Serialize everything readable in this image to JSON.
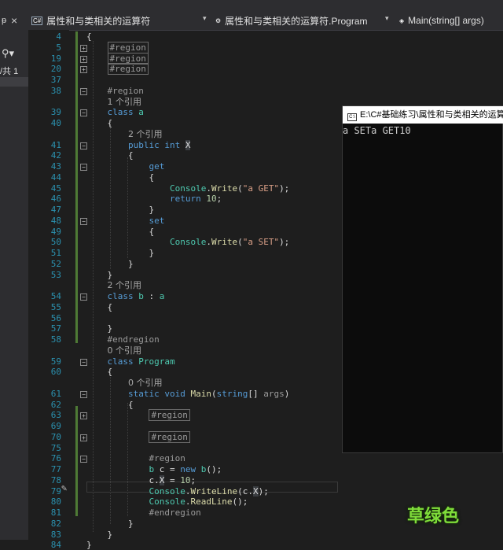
{
  "window": {
    "nav_file": "属性和与类相关的运算符",
    "nav_class": "属性和与类相关的运算符.Program",
    "nav_member": "Main(string[] args)",
    "icons": {
      "file": "csharp-file-icon",
      "class": "class-icon",
      "member": "method-icon"
    }
  },
  "side": {
    "pin": "ᵽ",
    "close": "×",
    "search": "⚲▾",
    "count": "/共 1"
  },
  "lines": [
    {
      "n": "4",
      "tokens": [
        {
          "t": "{",
          "c": ""
        }
      ]
    },
    {
      "n": "5",
      "tokens": [
        {
          "t": "    ",
          "c": ""
        },
        {
          "t": "#region",
          "c": "box"
        }
      ]
    },
    {
      "n": "19",
      "tokens": [
        {
          "t": "    ",
          "c": ""
        },
        {
          "t": "#region",
          "c": "box"
        }
      ]
    },
    {
      "n": "20",
      "tokens": [
        {
          "t": "    ",
          "c": ""
        },
        {
          "t": "#region",
          "c": "box"
        }
      ]
    },
    {
      "n": "37",
      "tokens": []
    },
    {
      "n": "38",
      "tokens": [
        {
          "t": "    ",
          "c": ""
        },
        {
          "t": "#region",
          "c": "grey"
        }
      ]
    },
    {
      "n": "",
      "tokens": [
        {
          "t": "    ",
          "c": ""
        },
        {
          "t": "1 个引用",
          "c": "ref"
        }
      ]
    },
    {
      "n": "39",
      "tokens": [
        {
          "t": "    ",
          "c": ""
        },
        {
          "t": "class",
          "c": "kw"
        },
        {
          "t": " ",
          "c": ""
        },
        {
          "t": "a",
          "c": "ty"
        }
      ]
    },
    {
      "n": "40",
      "tokens": [
        {
          "t": "    {",
          "c": ""
        }
      ]
    },
    {
      "n": "",
      "tokens": [
        {
          "t": "        ",
          "c": ""
        },
        {
          "t": "2 个引用",
          "c": "ref"
        }
      ]
    },
    {
      "n": "41",
      "tokens": [
        {
          "t": "        ",
          "c": ""
        },
        {
          "t": "public",
          "c": "kw"
        },
        {
          "t": " ",
          "c": ""
        },
        {
          "t": "int",
          "c": "kw"
        },
        {
          "t": " ",
          "c": ""
        },
        {
          "t": "X",
          "c": "hl"
        }
      ]
    },
    {
      "n": "42",
      "tokens": [
        {
          "t": "        {",
          "c": ""
        }
      ]
    },
    {
      "n": "43",
      "tokens": [
        {
          "t": "            ",
          "c": ""
        },
        {
          "t": "get",
          "c": "kw"
        }
      ]
    },
    {
      "n": "44",
      "tokens": [
        {
          "t": "            {",
          "c": ""
        }
      ]
    },
    {
      "n": "45",
      "tokens": [
        {
          "t": "                ",
          "c": ""
        },
        {
          "t": "Console",
          "c": "ty"
        },
        {
          "t": ".",
          "c": ""
        },
        {
          "t": "Write",
          "c": "me"
        },
        {
          "t": "(",
          "c": ""
        },
        {
          "t": "\"a GET\"",
          "c": "str"
        },
        {
          "t": ");",
          "c": ""
        }
      ]
    },
    {
      "n": "46",
      "tokens": [
        {
          "t": "                ",
          "c": ""
        },
        {
          "t": "return",
          "c": "kw"
        },
        {
          "t": " ",
          "c": ""
        },
        {
          "t": "10",
          "c": "num"
        },
        {
          "t": ";",
          "c": ""
        }
      ]
    },
    {
      "n": "47",
      "tokens": [
        {
          "t": "            }",
          "c": ""
        }
      ]
    },
    {
      "n": "48",
      "tokens": [
        {
          "t": "            ",
          "c": ""
        },
        {
          "t": "set",
          "c": "kw"
        }
      ]
    },
    {
      "n": "49",
      "tokens": [
        {
          "t": "            {",
          "c": ""
        }
      ]
    },
    {
      "n": "50",
      "tokens": [
        {
          "t": "                ",
          "c": ""
        },
        {
          "t": "Console",
          "c": "ty"
        },
        {
          "t": ".",
          "c": ""
        },
        {
          "t": "Write",
          "c": "me"
        },
        {
          "t": "(",
          "c": ""
        },
        {
          "t": "\"a SET\"",
          "c": "str"
        },
        {
          "t": ");",
          "c": ""
        }
      ]
    },
    {
      "n": "51",
      "tokens": [
        {
          "t": "            }",
          "c": ""
        }
      ]
    },
    {
      "n": "52",
      "tokens": [
        {
          "t": "        }",
          "c": ""
        }
      ]
    },
    {
      "n": "53",
      "tokens": [
        {
          "t": "    }",
          "c": ""
        }
      ]
    },
    {
      "n": "",
      "tokens": [
        {
          "t": "    ",
          "c": ""
        },
        {
          "t": "2 个引用",
          "c": "ref"
        }
      ]
    },
    {
      "n": "54",
      "tokens": [
        {
          "t": "    ",
          "c": ""
        },
        {
          "t": "class",
          "c": "kw"
        },
        {
          "t": " ",
          "c": ""
        },
        {
          "t": "b",
          "c": "ty"
        },
        {
          "t": " : ",
          "c": ""
        },
        {
          "t": "a",
          "c": "ty"
        }
      ]
    },
    {
      "n": "55",
      "tokens": [
        {
          "t": "    {",
          "c": ""
        }
      ]
    },
    {
      "n": "56",
      "tokens": []
    },
    {
      "n": "57",
      "tokens": [
        {
          "t": "    }",
          "c": ""
        }
      ]
    },
    {
      "n": "58",
      "tokens": [
        {
          "t": "    ",
          "c": ""
        },
        {
          "t": "#endregion",
          "c": "grey"
        }
      ]
    },
    {
      "n": "",
      "tokens": [
        {
          "t": "    ",
          "c": ""
        },
        {
          "t": "0 个引用",
          "c": "ref"
        }
      ]
    },
    {
      "n": "59",
      "tokens": [
        {
          "t": "    ",
          "c": ""
        },
        {
          "t": "class",
          "c": "kw"
        },
        {
          "t": " ",
          "c": ""
        },
        {
          "t": "Program",
          "c": "ty"
        }
      ]
    },
    {
      "n": "60",
      "tokens": [
        {
          "t": "    {",
          "c": ""
        }
      ]
    },
    {
      "n": "",
      "tokens": [
        {
          "t": "        ",
          "c": ""
        },
        {
          "t": "0 个引用",
          "c": "ref"
        }
      ]
    },
    {
      "n": "61",
      "tokens": [
        {
          "t": "        ",
          "c": ""
        },
        {
          "t": "static",
          "c": "kw"
        },
        {
          "t": " ",
          "c": ""
        },
        {
          "t": "void",
          "c": "kw"
        },
        {
          "t": " ",
          "c": ""
        },
        {
          "t": "Main",
          "c": "me"
        },
        {
          "t": "(",
          "c": ""
        },
        {
          "t": "string",
          "c": "kw"
        },
        {
          "t": "[] ",
          "c": ""
        },
        {
          "t": "args",
          "c": "grey"
        },
        {
          "t": ")",
          "c": ""
        }
      ]
    },
    {
      "n": "62",
      "tokens": [
        {
          "t": "        {",
          "c": ""
        }
      ]
    },
    {
      "n": "63",
      "tokens": [
        {
          "t": "            ",
          "c": ""
        },
        {
          "t": "#region",
          "c": "box"
        }
      ]
    },
    {
      "n": "69",
      "tokens": []
    },
    {
      "n": "70",
      "tokens": [
        {
          "t": "            ",
          "c": ""
        },
        {
          "t": "#region",
          "c": "box"
        }
      ]
    },
    {
      "n": "75",
      "tokens": []
    },
    {
      "n": "76",
      "tokens": [
        {
          "t": "            ",
          "c": ""
        },
        {
          "t": "#region",
          "c": "grey"
        }
      ]
    },
    {
      "n": "77",
      "tokens": [
        {
          "t": "            ",
          "c": ""
        },
        {
          "t": "b",
          "c": "ty"
        },
        {
          "t": " c = ",
          "c": ""
        },
        {
          "t": "new",
          "c": "kw"
        },
        {
          "t": " ",
          "c": ""
        },
        {
          "t": "b",
          "c": "ty"
        },
        {
          "t": "();",
          "c": ""
        }
      ]
    },
    {
      "n": "78",
      "tokens": [
        {
          "t": "            c.",
          "c": ""
        },
        {
          "t": "X",
          "c": "hl"
        },
        {
          "t": " = ",
          "c": ""
        },
        {
          "t": "10",
          "c": "num"
        },
        {
          "t": ";",
          "c": ""
        }
      ]
    },
    {
      "n": "79",
      "tokens": [
        {
          "t": "            ",
          "c": ""
        },
        {
          "t": "Console",
          "c": "ty"
        },
        {
          "t": ".",
          "c": ""
        },
        {
          "t": "WriteLine",
          "c": "me"
        },
        {
          "t": "(c.",
          "c": ""
        },
        {
          "t": "X",
          "c": "hl"
        },
        {
          "t": ");",
          "c": ""
        }
      ]
    },
    {
      "n": "80",
      "tokens": [
        {
          "t": "            ",
          "c": ""
        },
        {
          "t": "Console",
          "c": "ty"
        },
        {
          "t": ".",
          "c": ""
        },
        {
          "t": "ReadLine",
          "c": "me"
        },
        {
          "t": "();",
          "c": ""
        }
      ]
    },
    {
      "n": "81",
      "tokens": [
        {
          "t": "            ",
          "c": ""
        },
        {
          "t": "#endregion",
          "c": "grey"
        }
      ]
    },
    {
      "n": "82",
      "tokens": [
        {
          "t": "        }",
          "c": ""
        }
      ]
    },
    {
      "n": "83",
      "tokens": [
        {
          "t": "    }",
          "c": ""
        }
      ]
    },
    {
      "n": "84",
      "tokens": [
        {
          "t": "}",
          "c": ""
        }
      ]
    }
  ],
  "console": {
    "title": "E:\\C#基础练习\\属性和与类相关的运算符",
    "output": "a SETa GET10"
  },
  "watermark": "草绿色",
  "colors": {
    "background": "#1e1e1e",
    "keyword": "#569cd6",
    "type": "#4ec9b0",
    "string": "#d69d85",
    "line_number": "#2b91af",
    "change_bar": "#4e7a35",
    "watermark": "#7fdc3a"
  }
}
